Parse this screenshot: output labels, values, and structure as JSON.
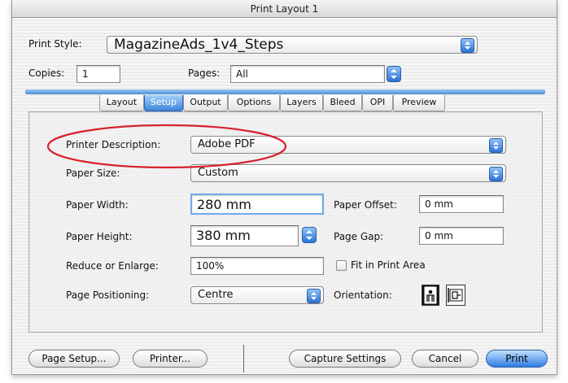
{
  "window": {
    "title": "Print Layout 1"
  },
  "top": {
    "print_style_label": "Print Style:",
    "print_style_value": "MagazineAds_1v4_Steps",
    "copies_label": "Copies:",
    "copies_value": "1",
    "pages_label": "Pages:",
    "pages_value": "All"
  },
  "tabs": [
    {
      "label": "Layout"
    },
    {
      "label": "Setup",
      "active": true
    },
    {
      "label": "Output"
    },
    {
      "label": "Options"
    },
    {
      "label": "Layers"
    },
    {
      "label": "Bleed"
    },
    {
      "label": "OPI"
    },
    {
      "label": "Preview"
    }
  ],
  "setup": {
    "printer_description_label": "Printer Description:",
    "printer_description_value": "Adobe PDF",
    "paper_size_label": "Paper Size:",
    "paper_size_value": "Custom",
    "paper_width_label": "Paper Width:",
    "paper_width_value": "280 mm",
    "paper_offset_label": "Paper Offset:",
    "paper_offset_value": "0 mm",
    "paper_height_label": "Paper Height:",
    "paper_height_value": "380 mm",
    "page_gap_label": "Page Gap:",
    "page_gap_value": "0 mm",
    "reduce_label": "Reduce or Enlarge:",
    "reduce_value": "100%",
    "fit_label": "Fit in Print Area",
    "fit_checked": false,
    "positioning_label": "Page Positioning:",
    "positioning_value": "Centre",
    "orientation_label": "Orientation:",
    "orientation_options": [
      "portrait-icon",
      "landscape-icon"
    ],
    "orientation_selected": "portrait-icon"
  },
  "buttons": {
    "page_setup": "Page Setup...",
    "printer": "Printer...",
    "capture": "Capture Settings",
    "cancel": "Cancel",
    "print": "Print"
  },
  "annotation": {
    "color": "#d9212b"
  }
}
